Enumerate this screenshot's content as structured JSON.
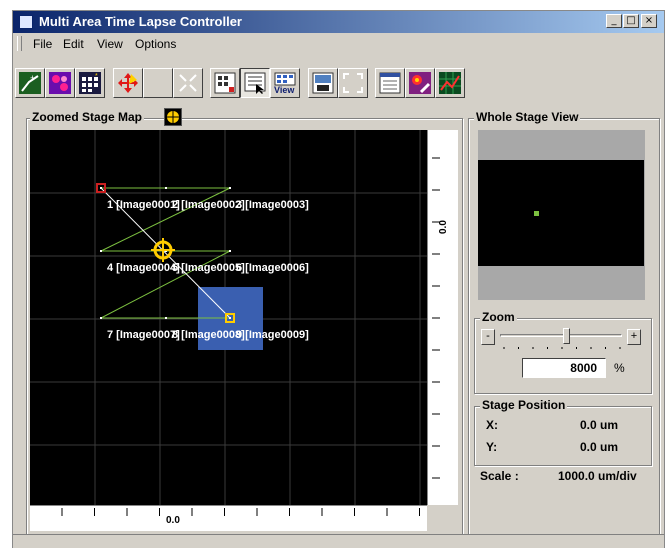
{
  "window": {
    "title": "Multi Area Time Lapse Controller"
  },
  "title_buttons": {
    "minimize": "_",
    "maximize": "□",
    "close": "×"
  },
  "menu": [
    "File",
    "Edit",
    "View",
    "Options"
  ],
  "toolbar": {
    "view_label": "View"
  },
  "zoomed_map": {
    "title": "Zoomed Stage Map",
    "v_axis_value": "0.0",
    "h_axis_value": "0.0",
    "labels": [
      "1 [Image0001]",
      "2 [Image0002]",
      "3 [Image0003]",
      "4 [Image0004]",
      "5 [Image0005]",
      "6 [Image0006]",
      "7 [Image0007]",
      "8 [Image0008]",
      "9 [Image0009]"
    ],
    "colors": {
      "path": "#7cc040",
      "jump": "#ffffff",
      "selection": "#3a5fb0",
      "marker": "#cc2020",
      "cursor": "#ffcc00"
    }
  },
  "whole_stage": {
    "title": "Whole Stage View"
  },
  "zoom": {
    "title": "Zoom",
    "minus": "-",
    "plus": "+",
    "value": "8000",
    "unit": "%",
    "slider_fraction": 0.55
  },
  "stage_position": {
    "title": "Stage Position",
    "x_label": "X:",
    "x_value": "0.0 um",
    "y_label": "Y:",
    "y_value": "0.0 um"
  },
  "scale": {
    "label": "Scale :",
    "value": "1000.0 um/div"
  }
}
